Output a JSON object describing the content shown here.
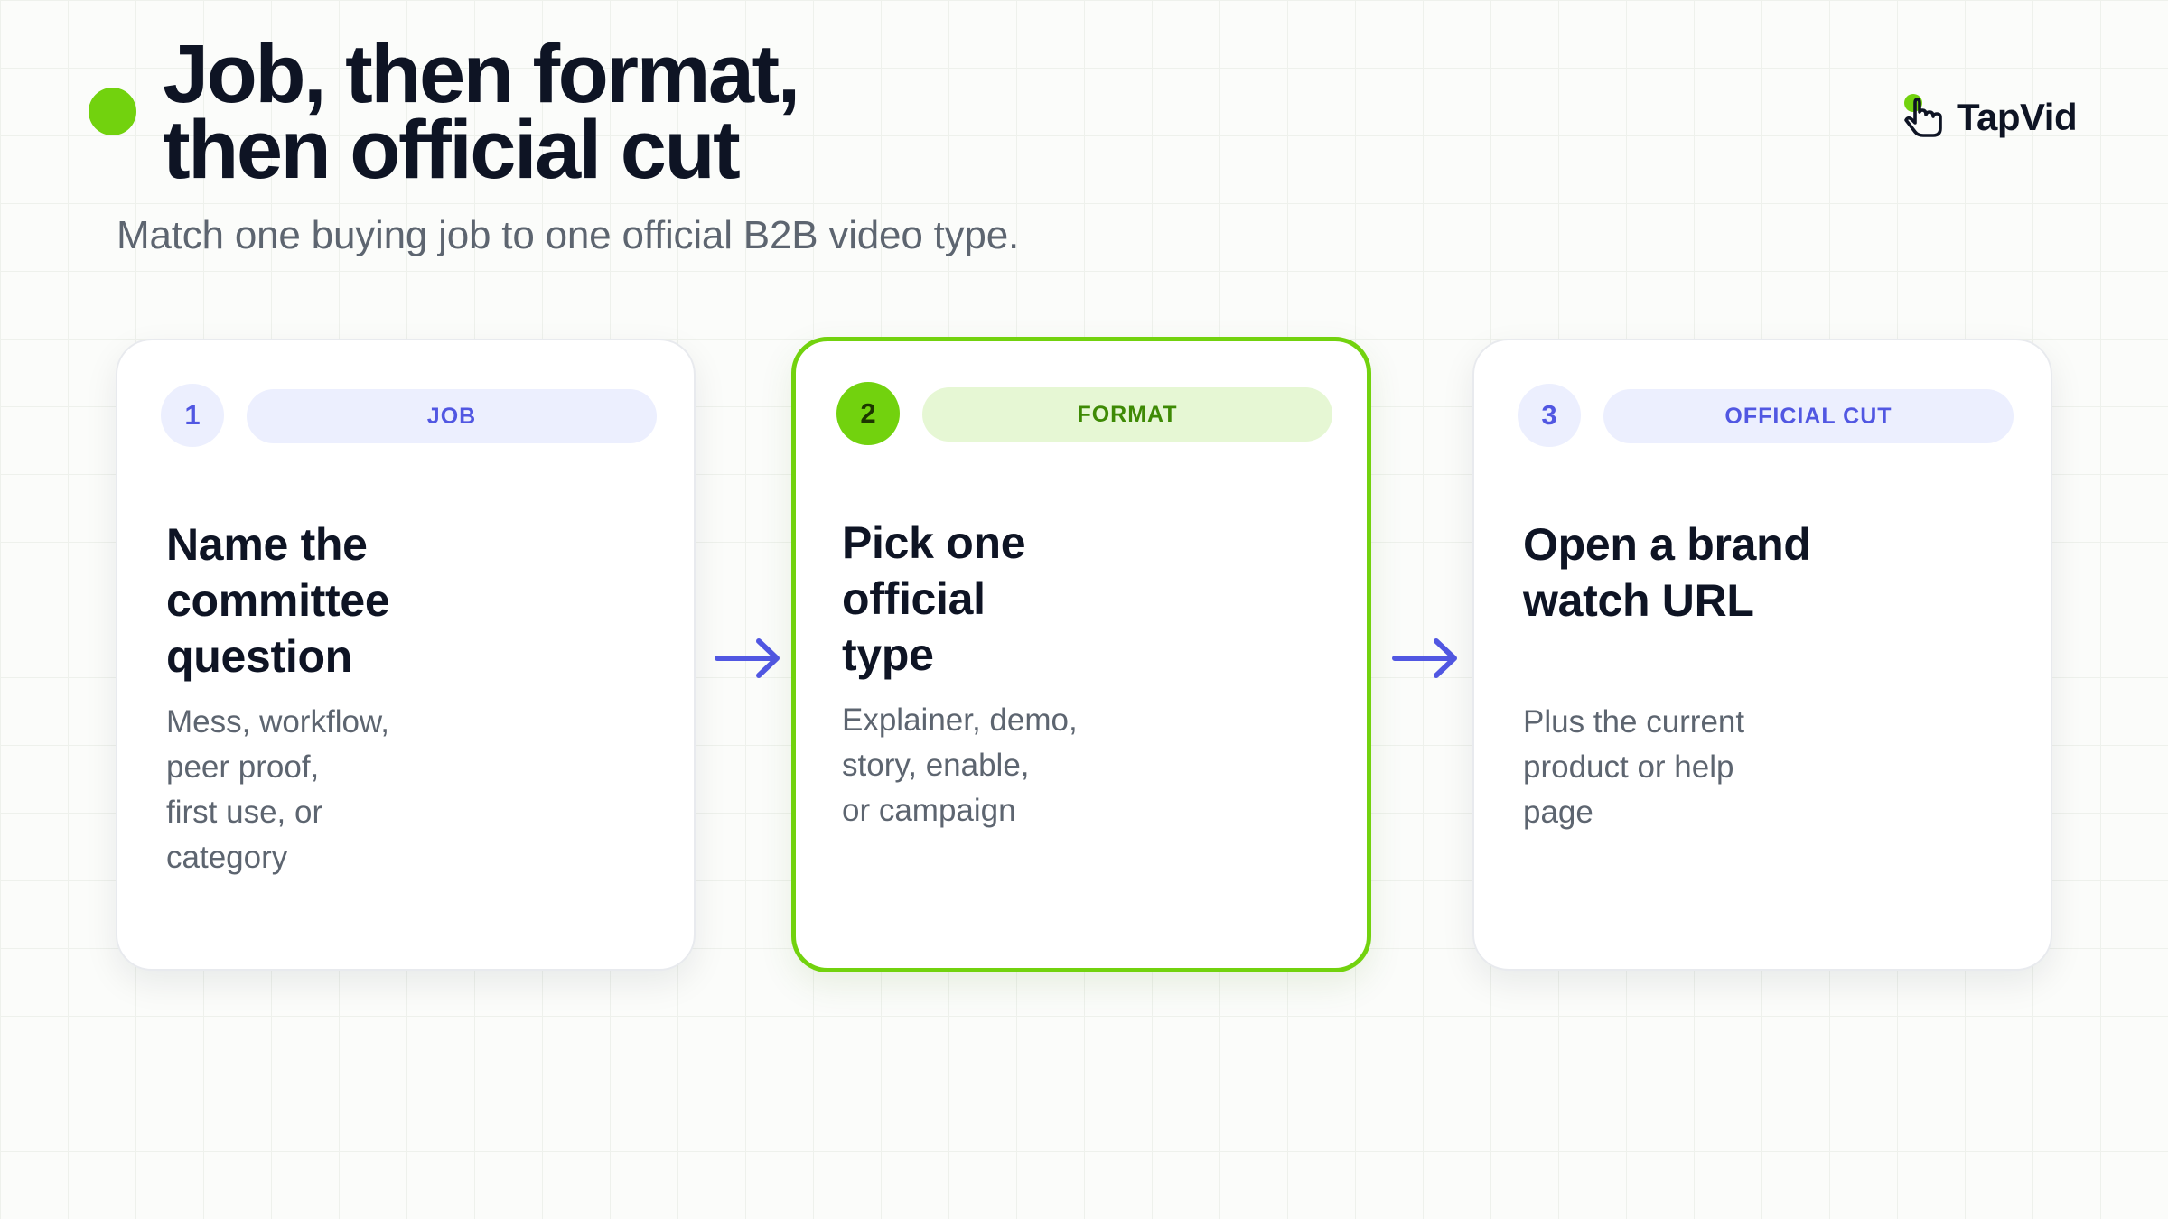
{
  "header": {
    "title_lines": [
      "Job, then format,",
      "then official cut"
    ],
    "subtitle": "Match one buying job to one official B2B video type."
  },
  "logo": {
    "text": "TapVid",
    "icon": "pointer-hand-icon",
    "dot_color": "#72d20e"
  },
  "colors": {
    "accent_green": "#72d20e",
    "accent_indigo": "#5157e2",
    "title_ink": "#0e1424",
    "body_gray": "#5d6570"
  },
  "steps": [
    {
      "number": "1",
      "tag": "JOB",
      "active": false,
      "title_lines": [
        "Name the",
        "committee",
        "question"
      ],
      "body_lines": [
        "Mess, workflow,",
        "peer proof,",
        "first use, or",
        "category"
      ]
    },
    {
      "number": "2",
      "tag": "FORMAT",
      "active": true,
      "title_lines": [
        "Pick one",
        "official",
        "type"
      ],
      "body_lines": [
        "Explainer, demo,",
        "story, enable,",
        "or campaign"
      ]
    },
    {
      "number": "3",
      "tag": "OFFICIAL CUT",
      "active": false,
      "title_lines": [
        "Open a brand",
        "watch URL"
      ],
      "body_lines": [
        "Plus the current",
        "product or help",
        "page"
      ]
    }
  ],
  "connectors": [
    "arrow-right-icon",
    "arrow-right-icon"
  ]
}
